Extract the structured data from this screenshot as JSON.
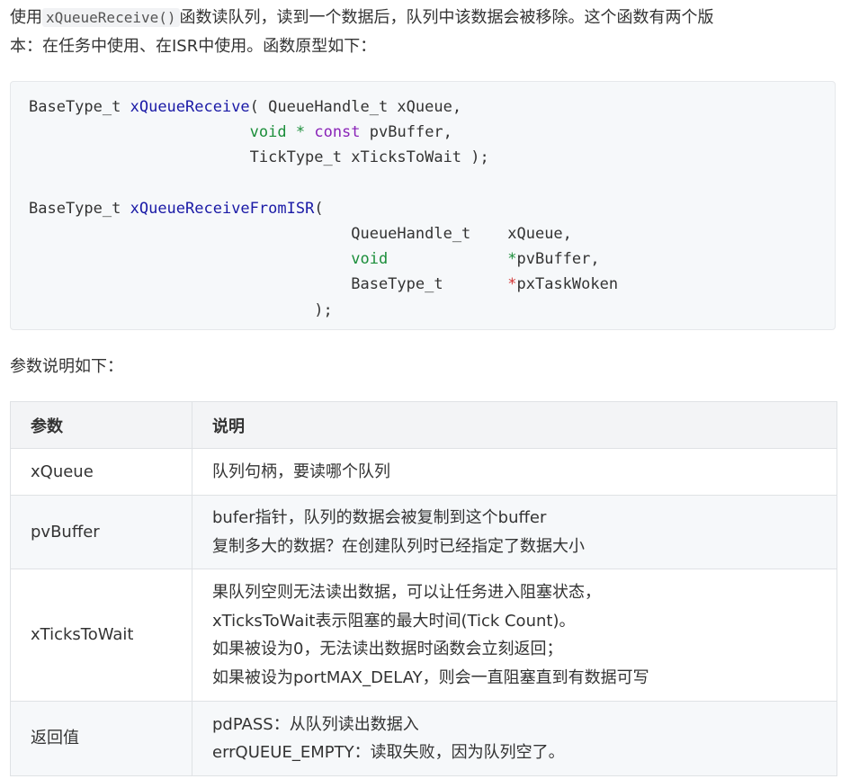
{
  "intro": {
    "prefix": "使用",
    "func_code": "xQueueReceive()",
    "line1_rest": "函数读队列，读到一个数据后，队列中该数据会被移除。这个函数有两个版",
    "line2": "本：在任务中使用、在ISR中使用。函数原型如下："
  },
  "code": {
    "type1": "BaseType_t",
    "fn1": "xQueueReceive",
    "open1": "( QueueHandle_t xQueue,",
    "void1": "void",
    "star1": "*",
    "const1": "const",
    "arg2": "pvBuffer,",
    "arg3": "TickType_t xTicksToWait );",
    "type2": "BaseType_t",
    "fn2": "xQueueReceiveFromISR",
    "open2": "(",
    "isr_a1_type": "QueueHandle_t",
    "isr_a1_name": "xQueue,",
    "isr_a2_type": "void",
    "isr_a2_star": "*",
    "isr_a2_name": "pvBuffer,",
    "isr_a3_type": "BaseType_t",
    "isr_a3_star": "*",
    "isr_a3_name": "pxTaskWoken",
    "close2": ");"
  },
  "params_label": "参数说明如下：",
  "table": {
    "headers": [
      "参数",
      "说明"
    ],
    "rows": [
      {
        "param": "xQueue",
        "desc": [
          "队列句柄，要读哪个队列"
        ]
      },
      {
        "param": "pvBuffer",
        "desc": [
          "bufer指针，队列的数据会被复制到这个buffer",
          "复制多大的数据？在创建队列时已经指定了数据大小"
        ]
      },
      {
        "param": "xTicksToWait",
        "desc": [
          "果队列空则无法读出数据，可以让任务进入阻塞状态，",
          "xTicksToWait表示阻塞的最大时间(Tick Count)。",
          "如果被设为0，无法读出数据时函数会立刻返回；",
          "如果被设为portMAX_DELAY，则会一直阻塞直到有数据可写"
        ]
      },
      {
        "param": "返回值",
        "desc": [
          "pdPASS：从队列读出数据入",
          "errQUEUE_EMPTY：读取失败，因为队列空了。"
        ]
      }
    ]
  },
  "colors": {
    "function": "#1a1aa6",
    "keyword": "#1b8e3a",
    "qualifier": "#8a24b8",
    "pointer": "#d23232",
    "code_bg": "#f6f8fa"
  }
}
